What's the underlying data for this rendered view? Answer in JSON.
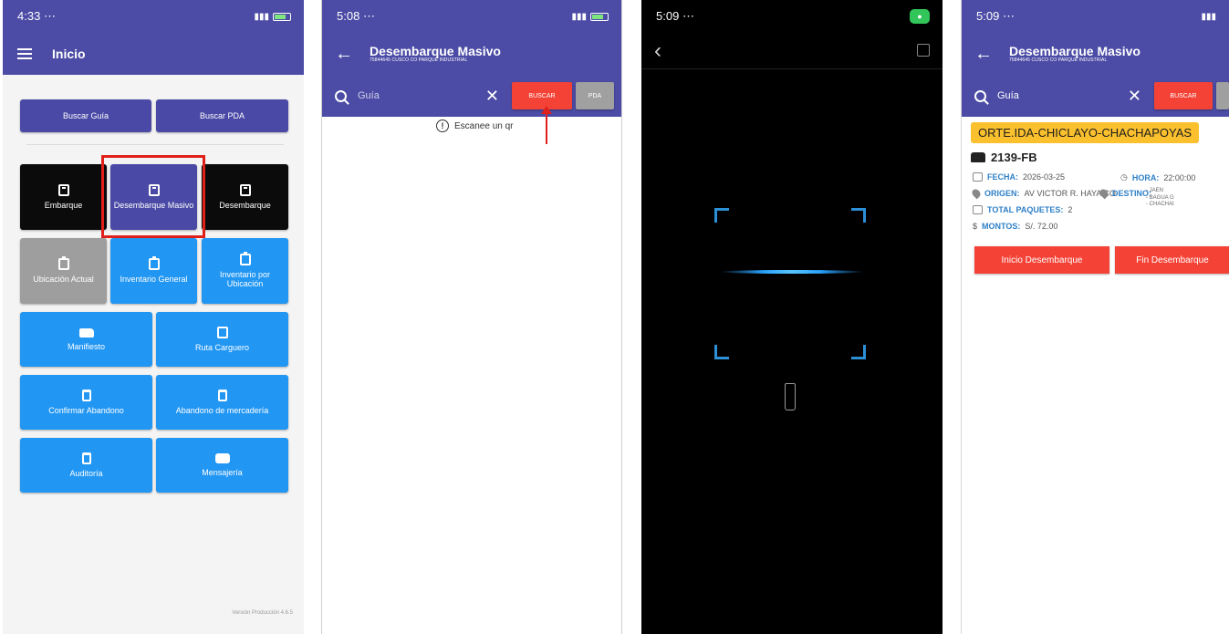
{
  "screen1": {
    "status_time": "4:33",
    "status_dots": "⋯",
    "title": "Inicio",
    "search_buttons": [
      "Buscar Guía",
      "Buscar PDA"
    ],
    "tiles": {
      "embarque": "Embarque",
      "desembarque_masivo": "Desembarque Masivo",
      "desembarque": "Desembarque",
      "ubicacion_actual": "Ubicación Actual",
      "inventario_general": "Inventario General",
      "inventario_ubicacion": "Inventario por Ubicación",
      "manifiesto": "Manifiesto",
      "ruta_carguero": "Ruta Carguero",
      "confirmar_abandono": "Confirmar Abandono",
      "abandono_mercaderia": "Abandono de mercadería",
      "auditoria": "Auditoría",
      "mensajeria": "Mensajería"
    },
    "version": "Versión Producción 4.6.5"
  },
  "screen2": {
    "status_time": "5:08",
    "status_dots": "⋯",
    "title": "Desembarque Masivo",
    "subtitle": "75844645 CUSCO CO PARQUE INDUSTRIAL",
    "search_placeholder": "Guía",
    "buscar_label": "BUSCAR",
    "pda_label": "PDA",
    "hint": "Escanee un qr"
  },
  "screen3": {
    "status_time": "5:09",
    "status_dots": "⋯"
  },
  "screen4": {
    "status_time": "5:09",
    "status_dots": "⋯",
    "title": "Desembarque Masivo",
    "subtitle": "75844645 CUSCO CO PARQUE INDUSTRIAL",
    "search_value": "Guía",
    "buscar_label": "BUSCAR",
    "route": "ORTE.IDA-CHICLAYO-CHACHAPOYAS",
    "plate": "2139-FB",
    "fecha_label": "FECHA:",
    "fecha": "2026-03-25",
    "hora_label": "HORA:",
    "hora": "22:00:00",
    "origen_label": "ORIGEN:",
    "origen": "AV VICTOR R. HAYA CO",
    "destino_label": "DESTINO:",
    "destino_lines": [
      "- JAEN",
      "- BAGUA G",
      "- CHACHAI"
    ],
    "total_label": "TOTAL PAQUETES:",
    "total": "2",
    "montos_label": "MONTOS:",
    "montos": "S/. 72.00",
    "inicio_btn": "Inicio Desembarque",
    "fin_btn": "Fin Desembarque"
  },
  "colors": {
    "primary": "#4c4ca6",
    "accent_blue": "#2196f3",
    "danger": "#f44336",
    "highlight": "#e0201b",
    "route_chip": "#fbc02d"
  }
}
